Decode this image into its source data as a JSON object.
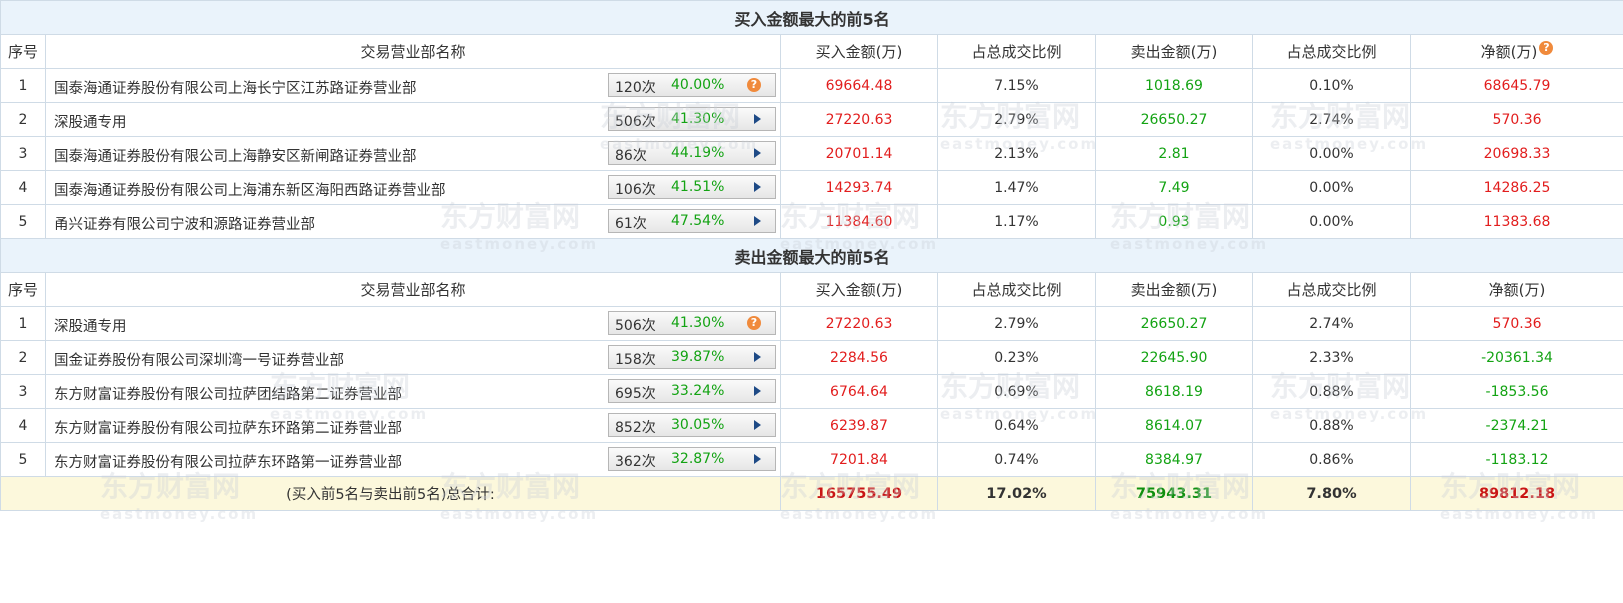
{
  "headers": [
    "序号",
    "交易营业部名称",
    "买入金额(万)",
    "占总成交比例",
    "卖出金额(万)",
    "占总成交比例",
    "净额(万)"
  ],
  "buy_section": {
    "title": "买入金额最大的前5名",
    "rows": [
      {
        "idx": "1",
        "name": "国泰海通证券股份有限公司上海长宁区江苏路证券营业部",
        "times": "120次",
        "pct": "40.00%",
        "icon": "help-icon",
        "buy": "69664.48",
        "buy_ratio": "7.15%",
        "sell": "1018.69",
        "sell_ratio": "0.10%",
        "net": "68645.79"
      },
      {
        "idx": "2",
        "name": "深股通专用",
        "times": "506次",
        "pct": "41.30%",
        "icon": "arrow-right-icon",
        "buy": "27220.63",
        "buy_ratio": "2.79%",
        "sell": "26650.27",
        "sell_ratio": "2.74%",
        "net": "570.36"
      },
      {
        "idx": "3",
        "name": "国泰海通证券股份有限公司上海静安区新闸路证券营业部",
        "times": "86次",
        "pct": "44.19%",
        "icon": "arrow-right-icon",
        "buy": "20701.14",
        "buy_ratio": "2.13%",
        "sell": "2.81",
        "sell_ratio": "0.00%",
        "net": "20698.33"
      },
      {
        "idx": "4",
        "name": "国泰海通证券股份有限公司上海浦东新区海阳西路证券营业部",
        "times": "106次",
        "pct": "41.51%",
        "icon": "arrow-right-icon",
        "buy": "14293.74",
        "buy_ratio": "1.47%",
        "sell": "7.49",
        "sell_ratio": "0.00%",
        "net": "14286.25"
      },
      {
        "idx": "5",
        "name": "甬兴证券有限公司宁波和源路证券营业部",
        "times": "61次",
        "pct": "47.54%",
        "icon": "arrow-right-icon",
        "buy": "11384.60",
        "buy_ratio": "1.17%",
        "sell": "0.93",
        "sell_ratio": "0.00%",
        "net": "11383.68"
      }
    ]
  },
  "sell_section": {
    "title": "卖出金额最大的前5名",
    "rows": [
      {
        "idx": "1",
        "name": "深股通专用",
        "times": "506次",
        "pct": "41.30%",
        "icon": "help-icon",
        "buy": "27220.63",
        "buy_ratio": "2.79%",
        "sell": "26650.27",
        "sell_ratio": "2.74%",
        "net": "570.36"
      },
      {
        "idx": "2",
        "name": "国金证券股份有限公司深圳湾一号证券营业部",
        "times": "158次",
        "pct": "39.87%",
        "icon": "arrow-right-icon",
        "buy": "2284.56",
        "buy_ratio": "0.23%",
        "sell": "22645.90",
        "sell_ratio": "2.33%",
        "net": "-20361.34"
      },
      {
        "idx": "3",
        "name": "东方财富证券股份有限公司拉萨团结路第二证券营业部",
        "times": "695次",
        "pct": "33.24%",
        "icon": "arrow-right-icon",
        "buy": "6764.64",
        "buy_ratio": "0.69%",
        "sell": "8618.19",
        "sell_ratio": "0.88%",
        "net": "-1853.56"
      },
      {
        "idx": "4",
        "name": "东方财富证券股份有限公司拉萨东环路第二证券营业部",
        "times": "852次",
        "pct": "30.05%",
        "icon": "arrow-right-icon",
        "buy": "6239.87",
        "buy_ratio": "0.64%",
        "sell": "8614.07",
        "sell_ratio": "0.88%",
        "net": "-2374.21"
      },
      {
        "idx": "5",
        "name": "东方财富证券股份有限公司拉萨东环路第一证券营业部",
        "times": "362次",
        "pct": "32.87%",
        "icon": "arrow-right-icon",
        "buy": "7201.84",
        "buy_ratio": "0.74%",
        "sell": "8384.97",
        "sell_ratio": "0.86%",
        "net": "-1183.12"
      }
    ]
  },
  "total": {
    "label": "(买入前5名与卖出前5名)总合计:",
    "buy": "165755.49",
    "buy_ratio": "17.02%",
    "sell": "75943.31",
    "sell_ratio": "7.80%",
    "net": "89812.18"
  },
  "help_glyph": "?",
  "watermark": {
    "cn": "东方财富网",
    "en": "eastmoney.com"
  },
  "colors": {
    "positive": "#e21d1d",
    "negative": "#13a313",
    "section_bg": "#eaf3fb",
    "total_bg": "#fcf8dc",
    "help": "#f08a3c"
  }
}
